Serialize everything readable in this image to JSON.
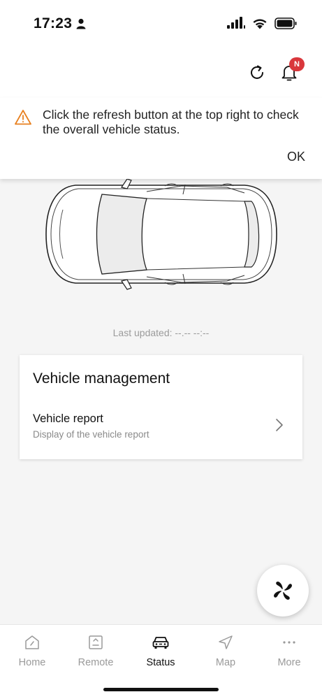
{
  "status_bar": {
    "time": "17:23",
    "icons": [
      "person-icon",
      "signal-icon",
      "wifi-icon",
      "battery-icon"
    ]
  },
  "header": {
    "icons": [
      "refresh-icon",
      "bell-icon"
    ],
    "notification_badge": "N"
  },
  "banner": {
    "icon": "warning-icon",
    "message": "Click the refresh button at the top right to check the overall vehicle status.",
    "ok_label": "OK",
    "accent_color": "#e8801f"
  },
  "vehicle": {
    "last_updated": "Last updated: --.-- --:--"
  },
  "vehicle_management": {
    "title": "Vehicle management",
    "items": [
      {
        "title": "Vehicle report",
        "subtitle": "Display of the vehicle report"
      }
    ]
  },
  "fab": {
    "icon": "fan-icon"
  },
  "tabs": [
    {
      "label": "Home",
      "icon": "home-icon",
      "active": false
    },
    {
      "label": "Remote",
      "icon": "remote-icon",
      "active": false
    },
    {
      "label": "Status",
      "icon": "car-icon",
      "active": true
    },
    {
      "label": "Map",
      "icon": "navigation-icon",
      "active": false
    },
    {
      "label": "More",
      "icon": "more-icon",
      "active": false
    }
  ],
  "colors": {
    "badge": "#d9373c",
    "background": "#f5f5f5",
    "active_tab": "#111111",
    "inactive_tab": "#9a9a9a"
  }
}
